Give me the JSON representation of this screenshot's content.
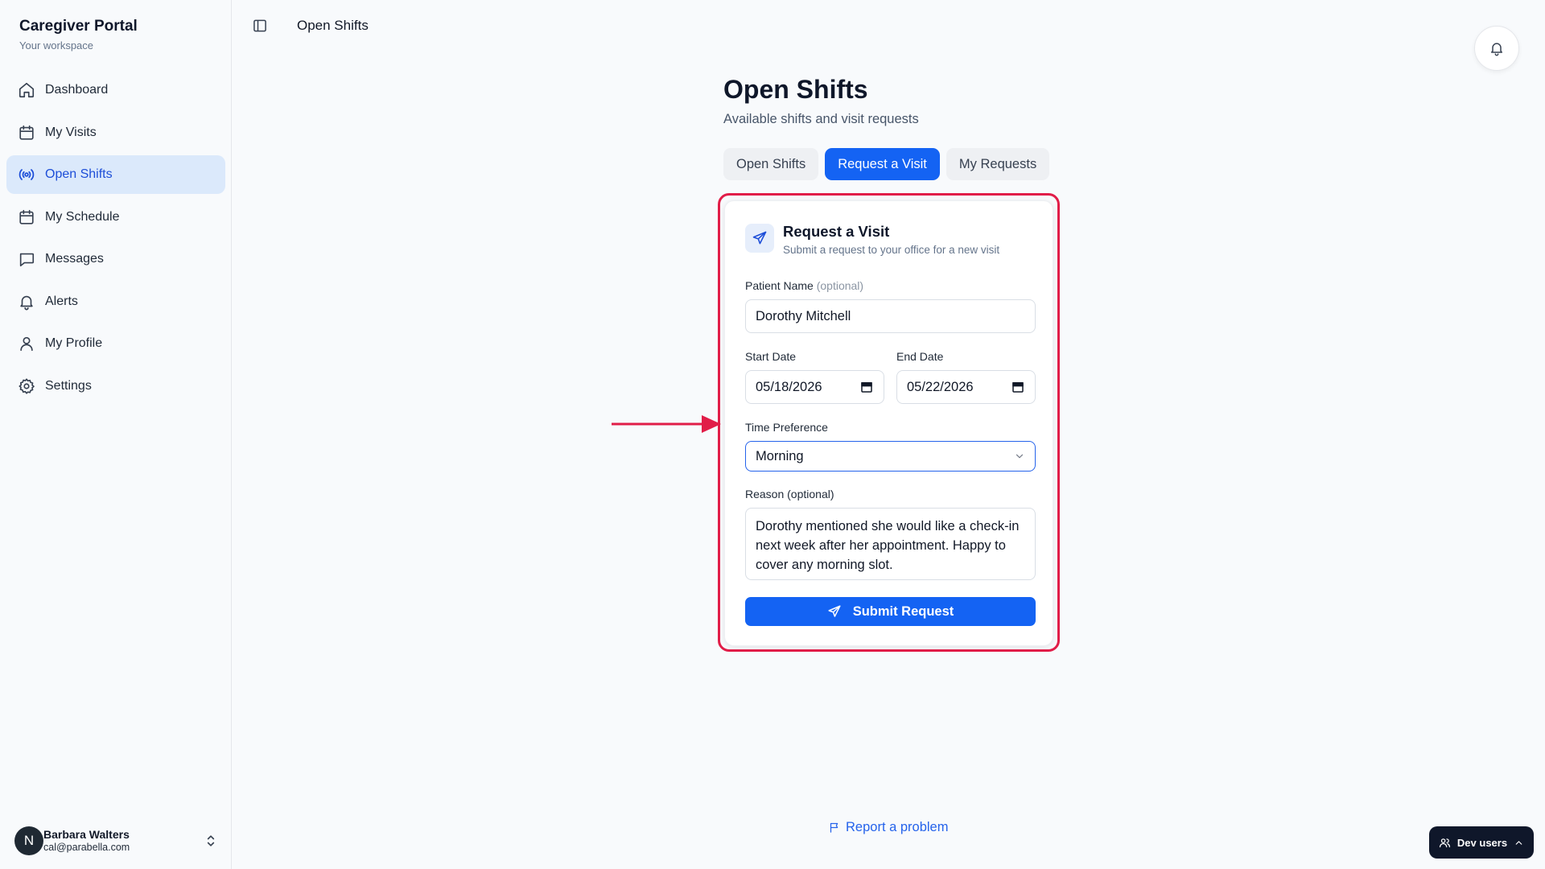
{
  "sidebar": {
    "brand_title": "Caregiver Portal",
    "brand_subtitle": "Your workspace",
    "items": [
      {
        "label": "Dashboard",
        "icon": "home-icon"
      },
      {
        "label": "My Visits",
        "icon": "calendar-icon"
      },
      {
        "label": "Open Shifts",
        "icon": "broadcast-icon",
        "active": true
      },
      {
        "label": "My Schedule",
        "icon": "calendar-icon"
      },
      {
        "label": "Messages",
        "icon": "message-icon"
      },
      {
        "label": "Alerts",
        "icon": "bell-icon"
      },
      {
        "label": "My Profile",
        "icon": "user-icon"
      },
      {
        "label": "Settings",
        "icon": "gear-icon"
      }
    ],
    "user": {
      "initial": "N",
      "name": "Barbara Walters",
      "email": "cal@parabella.com"
    }
  },
  "header": {
    "title": "Open Shifts"
  },
  "main": {
    "title": "Open Shifts",
    "subtitle": "Available shifts and visit requests",
    "tabs": [
      {
        "label": "Open Shifts"
      },
      {
        "label": "Request a Visit",
        "active": true
      },
      {
        "label": "My Requests"
      }
    ]
  },
  "form": {
    "title": "Request a Visit",
    "subtitle": "Submit a request to your office for a new visit",
    "patient_label": "Patient Name",
    "patient_optional": "(optional)",
    "patient_value": "Dorothy Mitchell",
    "start_label": "Start Date",
    "start_value": "05/18/2026",
    "end_label": "End Date",
    "end_value": "05/22/2026",
    "time_label": "Time Preference",
    "time_value": "Morning",
    "reason_label": "Reason (optional)",
    "reason_value": "Dorothy mentioned she would like a check-in next week after her appointment. Happy to cover any morning slot.",
    "submit_label": "Submit Request"
  },
  "footer": {
    "report_label": "Report a problem",
    "dev_users_label": "Dev users"
  },
  "colors": {
    "accent": "#1463f3",
    "highlight": "#e11d48",
    "active_nav_bg": "#dbe9fb"
  }
}
